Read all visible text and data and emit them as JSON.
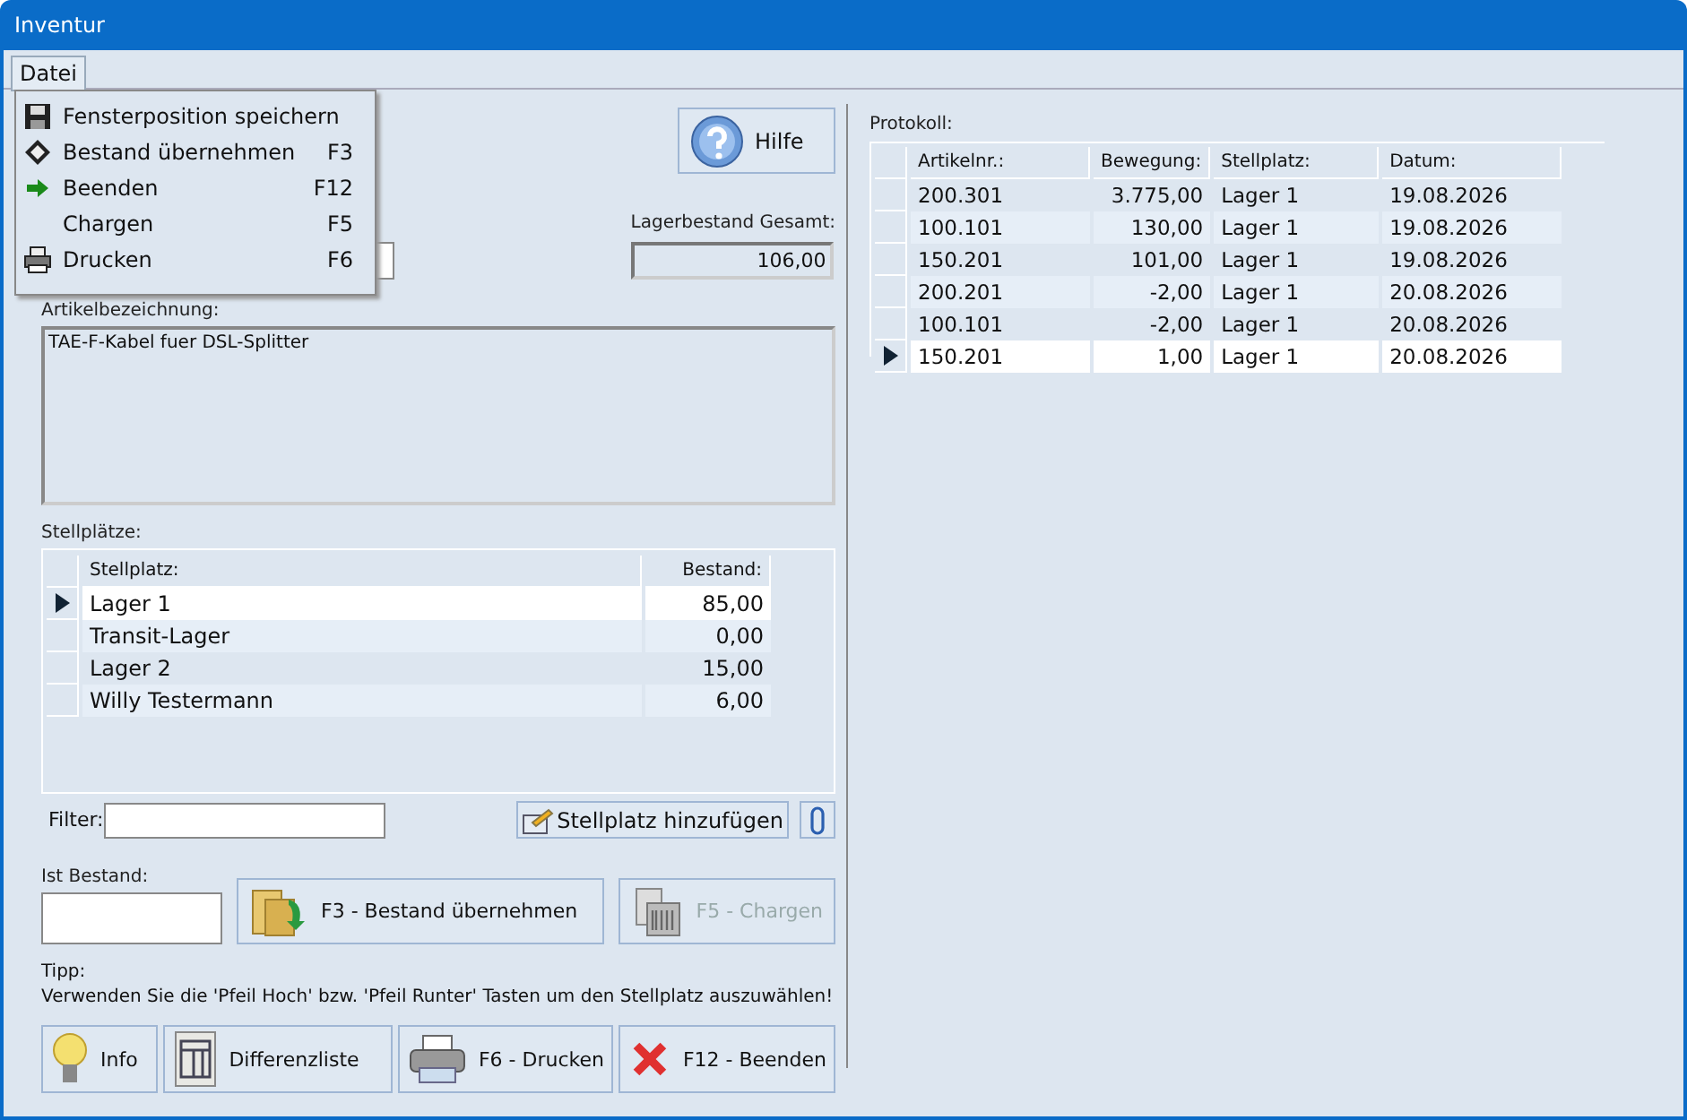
{
  "window": {
    "title": "Inventur"
  },
  "menu_bar": [
    {
      "label": "Datei",
      "expanded": true
    }
  ],
  "file_menu": [
    {
      "label": "Fensterposition speichern"
    },
    {
      "label": "Bestand übernehmen",
      "shortcut": "F3"
    },
    {
      "label": "Beenden",
      "shortcut": "F12"
    },
    {
      "label": "Chargen",
      "shortcut": "F5"
    },
    {
      "label": "Drucken",
      "shortcut": "F6"
    }
  ],
  "help_button": {
    "label": "Hilfe"
  },
  "total_stock": {
    "label": "Lagerbestand Gesamt:",
    "value": "106,00"
  },
  "description": {
    "label": "Artikelbezeichnung:",
    "value": "TAE-F-Kabel fuer DSL-Splitter"
  },
  "locations": {
    "label": "Stellplätze:",
    "columns": [
      "Stellplatz:",
      "Bestand:"
    ],
    "rows": [
      {
        "cells": [
          "Lager 1",
          "85,00"
        ],
        "selected": true
      },
      {
        "cells": [
          "Transit-Lager",
          "0,00"
        ],
        "selected": false
      },
      {
        "cells": [
          "Lager 2",
          "15,00"
        ],
        "selected": false
      },
      {
        "cells": [
          "Willy Testermann",
          "6,00"
        ],
        "selected": false
      }
    ]
  },
  "filter": {
    "label": "Filter:"
  },
  "add_location_button": {
    "label": "Stellplatz hinzufügen"
  },
  "actual_stock": {
    "label": "Ist Bestand:"
  },
  "action_buttons": [
    {
      "label": "F3 - Bestand übernehmen",
      "disabled": false
    },
    {
      "label": "F5 - Chargen",
      "disabled": true
    }
  ],
  "tip": {
    "label": "Tipp:",
    "text": "Verwenden Sie die 'Pfeil Hoch' bzw. 'Pfeil Runter' Tasten um den Stellplatz auszuwählen!"
  },
  "bottom_buttons": [
    {
      "label": "Info"
    },
    {
      "label": "Differenzliste"
    },
    {
      "label": "F6 - Drucken"
    },
    {
      "label": "F12 - Beenden"
    }
  ],
  "log": {
    "label": "Protokoll:",
    "columns": [
      "Artikelnr.:",
      "Bewegung:",
      "Stellplatz:",
      "Datum:"
    ],
    "rows": [
      {
        "cells": [
          "200.301",
          "3.775,00",
          "Lager 1",
          "19.08.2026"
        ],
        "selected": false
      },
      {
        "cells": [
          "100.101",
          "130,00",
          "Lager 1",
          "19.08.2026"
        ],
        "selected": false
      },
      {
        "cells": [
          "150.201",
          "101,00",
          "Lager 1",
          "19.08.2026"
        ],
        "selected": false
      },
      {
        "cells": [
          "200.201",
          "-2,00",
          "Lager 1",
          "20.08.2026"
        ],
        "selected": false
      },
      {
        "cells": [
          "100.101",
          "-2,00",
          "Lager 1",
          "20.08.2026"
        ],
        "selected": false
      },
      {
        "cells": [
          "150.201",
          "1,00",
          "Lager 1",
          "20.08.2026"
        ],
        "selected": true
      }
    ]
  }
}
